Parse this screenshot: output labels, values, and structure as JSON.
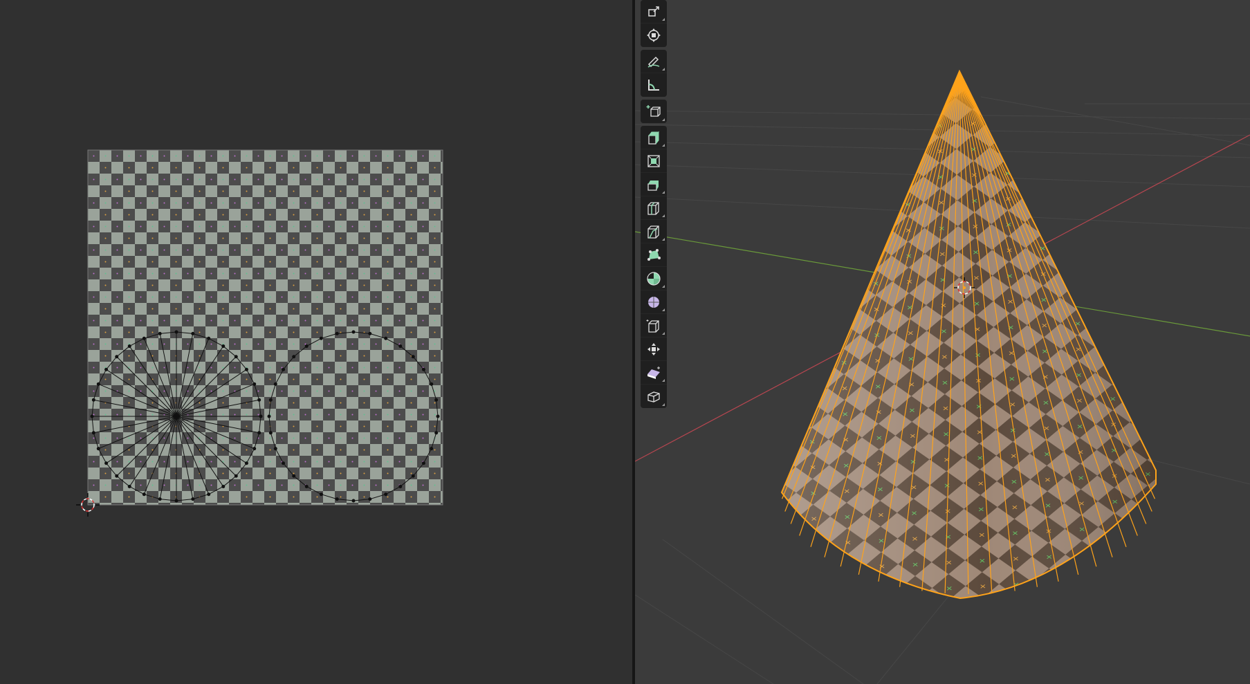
{
  "colors": {
    "background": "#303030",
    "viewport_background": "#3b3b3b",
    "grid": "#4a4a4a",
    "axis_x": "#b84650",
    "axis_y": "#6a9a3a",
    "selection_edge": "#ffa31a",
    "tool_icon_accent": "#8fd8b0",
    "uv_edge": "#111111",
    "checker_light": "#9aa39a",
    "checker_dark": "#4c4c4c"
  },
  "uv_editor": {
    "texture": "checker-grid",
    "cursor": "2d-cursor-icon",
    "islands": [
      "cone-cap-fan",
      "cone-base-circle"
    ]
  },
  "viewport": {
    "object": "Cone",
    "origin": "object-origin-icon"
  },
  "toolbar": {
    "tools": [
      {
        "id": "scale-cage",
        "icon": "scale-cage-icon"
      },
      {
        "id": "transform",
        "icon": "transform-icon"
      },
      {
        "id": "annotate",
        "icon": "annotate-icon"
      },
      {
        "id": "measure",
        "icon": "measure-icon"
      },
      {
        "id": "add-cube",
        "icon": "add-cube-icon"
      },
      {
        "id": "extrude-region",
        "icon": "extrude-region-icon"
      },
      {
        "id": "inset-faces",
        "icon": "inset-faces-icon"
      },
      {
        "id": "bevel",
        "icon": "bevel-icon"
      },
      {
        "id": "loop-cut",
        "icon": "loop-cut-icon"
      },
      {
        "id": "knife",
        "icon": "knife-icon"
      },
      {
        "id": "poly-build",
        "icon": "poly-build-icon"
      },
      {
        "id": "spin",
        "icon": "spin-icon"
      },
      {
        "id": "smooth",
        "icon": "smooth-icon"
      },
      {
        "id": "edge-slide",
        "icon": "edge-slide-icon"
      },
      {
        "id": "shrink-fatten",
        "icon": "shrink-fatten-icon"
      },
      {
        "id": "shear",
        "icon": "shear-icon"
      },
      {
        "id": "rip-region",
        "icon": "rip-region-icon"
      }
    ]
  }
}
